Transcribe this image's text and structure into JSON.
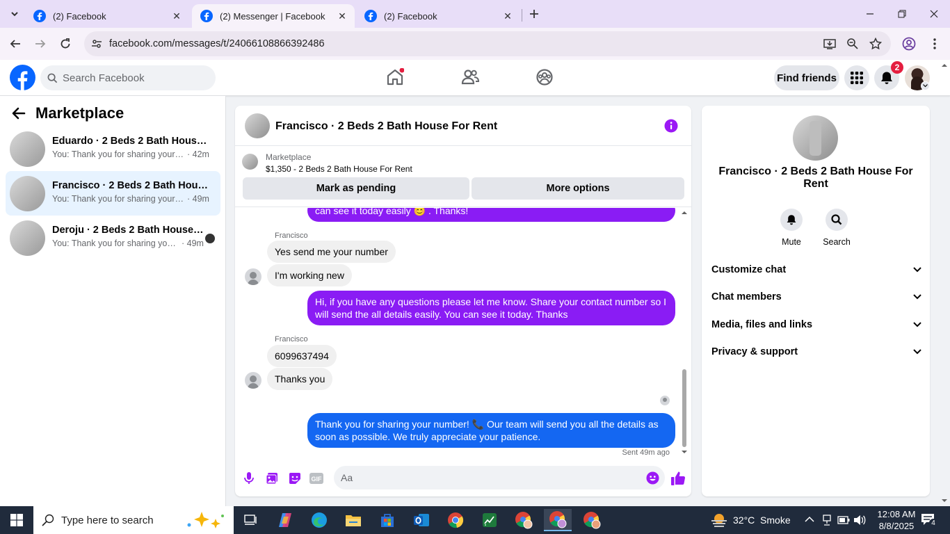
{
  "browser": {
    "tabs": [
      {
        "title": "(2) Facebook",
        "active": false
      },
      {
        "title": "(2) Messenger | Facebook",
        "active": true
      },
      {
        "title": "(2) Facebook",
        "active": false
      }
    ],
    "url": "facebook.com/messages/t/24066108866392486"
  },
  "fb_header": {
    "search_placeholder": "Search Facebook",
    "find_friends_label": "Find friends",
    "notification_count": "2",
    "brand_color": "#0866ff"
  },
  "sidebar": {
    "title": "Marketplace",
    "conversations": [
      {
        "name": "Eduardo · 2 Beds 2 Bath House For Rent",
        "preview": "You: Thank you for sharing your number!",
        "time": "· 42m",
        "active": false
      },
      {
        "name": "Francisco · 2 Beds 2 Bath House For Rent",
        "preview": "You: Thank you for sharing your number!",
        "time": "· 49m",
        "active": true
      },
      {
        "name": "Deroju · 2 Beds 2 Bath House For Rent",
        "preview": "You: Thank you for sharing your number!",
        "time": "· 49m",
        "active": false
      }
    ]
  },
  "chat": {
    "title": "Francisco · 2 Beds 2 Bath House For Rent",
    "marketplace_label": "Marketplace",
    "listing": "$1,350 - 2 Beds 2 Bath House For Rent",
    "mark_pending_label": "Mark as pending",
    "more_options_label": "More options",
    "messages": {
      "m0": "can see it today easily 😊 . Thanks!",
      "sender1": "Francisco",
      "m1": "Yes send me your number",
      "m2": "I'm working new",
      "m3": "Hi, if you have any questions please let me know. Share your contact number so I will send the all details easily. You can see it today. Thanks",
      "sender2": "Francisco",
      "m4": "6099637494",
      "m5": "Thanks you",
      "m6": "Thank you for sharing your number! 📞 Our team will send you all the details as soon as possible. We truly appreciate your patience."
    },
    "sent_status": "Sent 49m ago",
    "composer_placeholder": "Aa",
    "out_color": "#8a1cf4",
    "out_color_latest": "#1467f2"
  },
  "info_panel": {
    "name": "Francisco · 2 Beds 2 Bath House For Rent",
    "mute_label": "Mute",
    "search_label": "Search",
    "sections": [
      "Customize chat",
      "Chat members",
      "Media, files and links",
      "Privacy & support"
    ]
  },
  "taskbar": {
    "search_placeholder": "Type here to search",
    "weather": "32°C  Smoke",
    "time": "12:08 AM",
    "date": "8/8/2025",
    "notifications": "4"
  }
}
